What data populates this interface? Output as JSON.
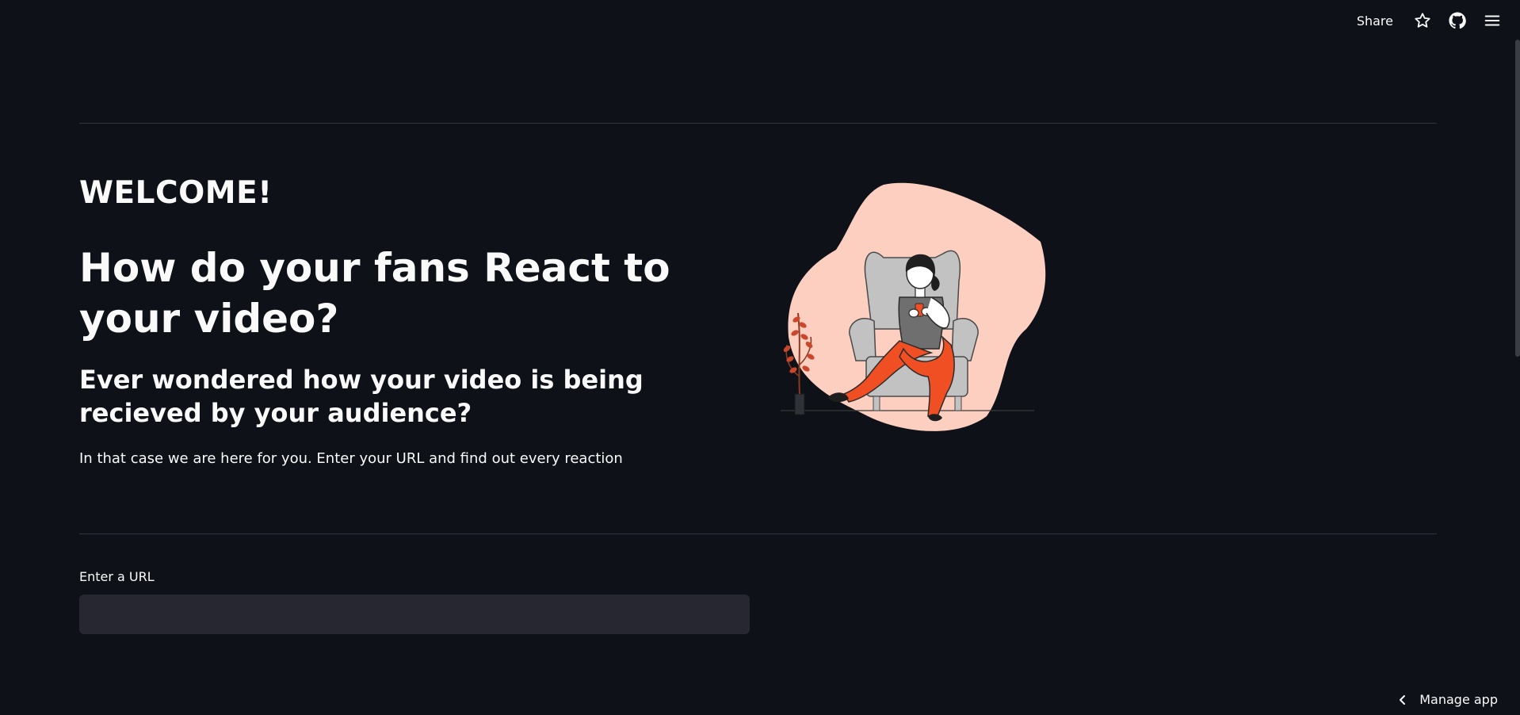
{
  "toolbar": {
    "share_label": "Share",
    "icons": [
      "star-icon",
      "github-icon",
      "menu-icon"
    ]
  },
  "hero": {
    "welcome": "WELCOME!",
    "headline": "How do your fans React to your video?",
    "subheadline": "Ever wondered how your video is being recieved by your audience?",
    "body": "In that case we are here for you. Enter your URL and find out every reaction"
  },
  "illustration": {
    "icon": "woman-reading-on-armchair-illustration",
    "colors": {
      "blob": "#fdcfc0",
      "pants": "#f04e23",
      "chair": "#c2c2c2",
      "plant": "#c9472b"
    }
  },
  "url_form": {
    "label": "Enter a URL",
    "value": "",
    "placeholder": ""
  },
  "footer": {
    "manage_app_label": "Manage app"
  },
  "theme": {
    "background": "#0e1117",
    "text": "#fafafa",
    "input_bg": "#262730",
    "divider": "#31333f"
  }
}
